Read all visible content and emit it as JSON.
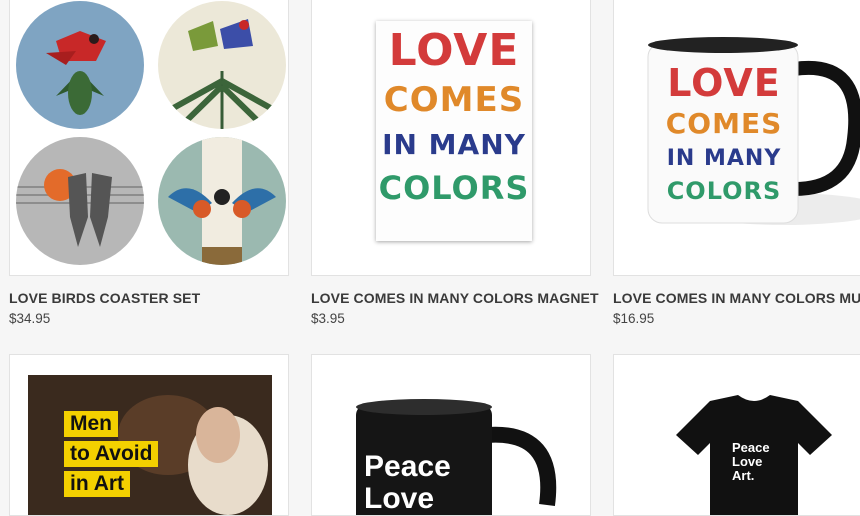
{
  "products": [
    {
      "title": "LOVE BIRDS COASTER SET",
      "price": "$34.95"
    },
    {
      "title": "LOVE COMES IN MANY COLORS MAGNET",
      "price": "$3.95"
    },
    {
      "title": "LOVE COMES IN MANY COLORS MUG",
      "price": "$16.95"
    },
    {
      "title": "",
      "price": ""
    },
    {
      "title": "",
      "price": ""
    },
    {
      "title": "",
      "price": ""
    }
  ],
  "magnet_lines": [
    "LOVE",
    "COMES",
    "IN MANY",
    "COLORS"
  ],
  "mug_lines": [
    "LOVE",
    "COMES",
    "IN MANY",
    "COLORS"
  ],
  "book_lines": [
    "Men",
    "to Avoid",
    "in Art"
  ],
  "black_mug_lines": [
    "Peace",
    "Love"
  ],
  "tshirt_lines": [
    "Peace",
    "Love",
    "Art."
  ],
  "colors": {
    "page_bg": "#f6f6f6",
    "card_border": "#e2e2e2",
    "title": "#3a3a3a",
    "book_yellow": "#f3d000"
  }
}
